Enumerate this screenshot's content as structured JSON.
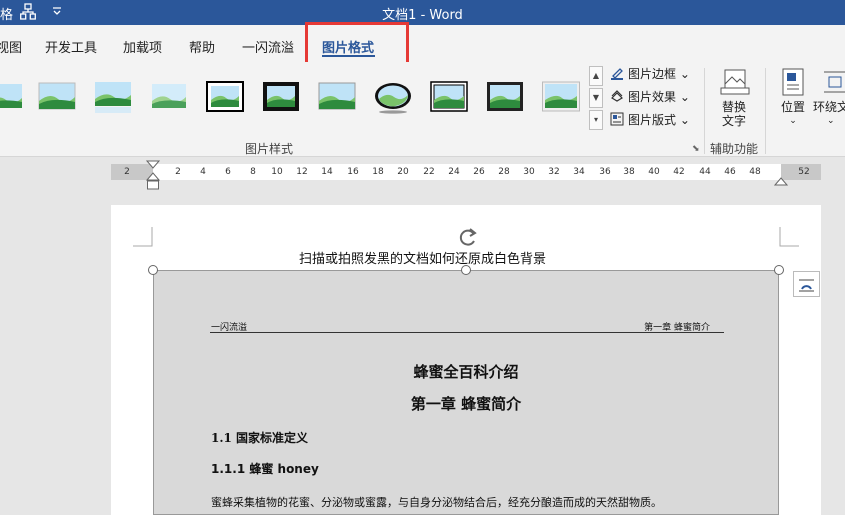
{
  "window": {
    "title": "文档1  -  Word"
  },
  "quick_access": {
    "left_fragment": "格",
    "org_chart_icon": "org-chart-icon",
    "dropdown_icon": "customize-dropdown-icon"
  },
  "tabs": [
    {
      "label": "视图"
    },
    {
      "label": "开发工具"
    },
    {
      "label": "加载项"
    },
    {
      "label": "帮助"
    },
    {
      "label": "一闪流溢"
    },
    {
      "label": "图片格式",
      "active": true
    }
  ],
  "ribbon": {
    "styles_group_label": "图片样式",
    "commands": {
      "border": "图片边框",
      "effects": "图片效果",
      "layout": "图片版式"
    },
    "alt_text": {
      "line1": "替换",
      "line2": "文字"
    },
    "accessibility_group_label": "辅助功能",
    "position": "位置",
    "wrap_text": "环绕文"
  },
  "ruler": {
    "numbers": [
      "2",
      "2",
      "4",
      "6",
      "8",
      "10",
      "12",
      "14",
      "16",
      "18",
      "20",
      "22",
      "24",
      "26",
      "28",
      "30",
      "32",
      "34",
      "36",
      "38",
      "40",
      "42",
      "44",
      "46",
      "48",
      "52"
    ]
  },
  "document": {
    "caption": "扫描或拍照发黑的文档如何还原成白色背景",
    "image": {
      "header_left": "一闪流溢",
      "header_right": "第一章  蜂蜜简介",
      "title": "蜂蜜全百科介绍",
      "chapter": "第一章 蜂蜜简介",
      "section": "1.1 国家标准定义",
      "subsection": "1.1.1 蜂蜜 honey",
      "body": "蜜蜂采集植物的花蜜、分泌物或蜜露，与自身分泌物结合后，经充分酿造而成的天然甜物质。"
    }
  },
  "colors": {
    "title_bar": "#2b579a",
    "active_tab": "#2b579a",
    "highlight_box": "#e53935",
    "ribbon_bg": "#f3f3f3",
    "image_bg": "#d9d9d9"
  }
}
